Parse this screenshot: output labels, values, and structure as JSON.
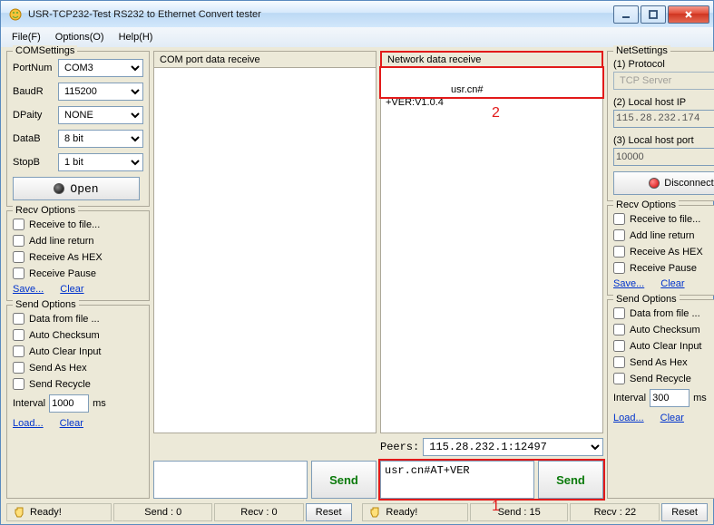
{
  "window": {
    "title": "USR-TCP232-Test  RS232 to Ethernet Convert tester"
  },
  "menu": {
    "file": "File(F)",
    "options": "Options(O)",
    "help": "Help(H)"
  },
  "com": {
    "legend": "COMSettings",
    "portnum_k": "PortNum",
    "portnum_v": "COM3",
    "baud_k": "BaudR",
    "baud_v": "115200",
    "parity_k": "DPaity",
    "parity_v": "NONE",
    "datab_k": "DataB",
    "datab_v": "8 bit",
    "stopb_k": "StopB",
    "stopb_v": "1 bit",
    "open": "Open"
  },
  "recvopt": {
    "legend": "Recv Options",
    "tofile": "Receive to file...",
    "addline": "Add line return",
    "ashex": "Receive As HEX",
    "pause": "Receive Pause",
    "save": "Save...",
    "clear": "Clear"
  },
  "sendopt": {
    "legend": "Send Options",
    "fromfile": "Data from file ...",
    "autock": "Auto Checksum",
    "autoclr": "Auto Clear Input",
    "ashex": "Send As Hex",
    "recycle": "Send Recycle",
    "interval_k": "Interval",
    "interval_left": "1000",
    "interval_right": "300",
    "ms": "ms",
    "load": "Load...",
    "clear": "Clear"
  },
  "mid": {
    "com_title": "COM port data receive",
    "net_title": "Network data receive",
    "net_body": "usr.cn#\n+VER:V1.0.4",
    "peers_k": "Peers:",
    "peers_v": "115.28.232.1:12497",
    "send_right": "usr.cn#AT+VER",
    "send_left": "",
    "send_btn": "Send",
    "annot1": "1",
    "annot2": "2"
  },
  "net": {
    "legend": "NetSettings",
    "proto_k": "(1) Protocol",
    "proto_v": "TCP Server",
    "ip_k": "(2) Local host IP",
    "ip_v": "115.28.232.174",
    "port_k": "(3) Local host port",
    "port_v": "10000",
    "disconnect": "Disconnect"
  },
  "status": {
    "ready": "Ready!",
    "send0": "Send : 0",
    "recv0": "Recv : 0",
    "send15": "Send : 15",
    "recv22": "Recv : 22",
    "reset": "Reset"
  }
}
